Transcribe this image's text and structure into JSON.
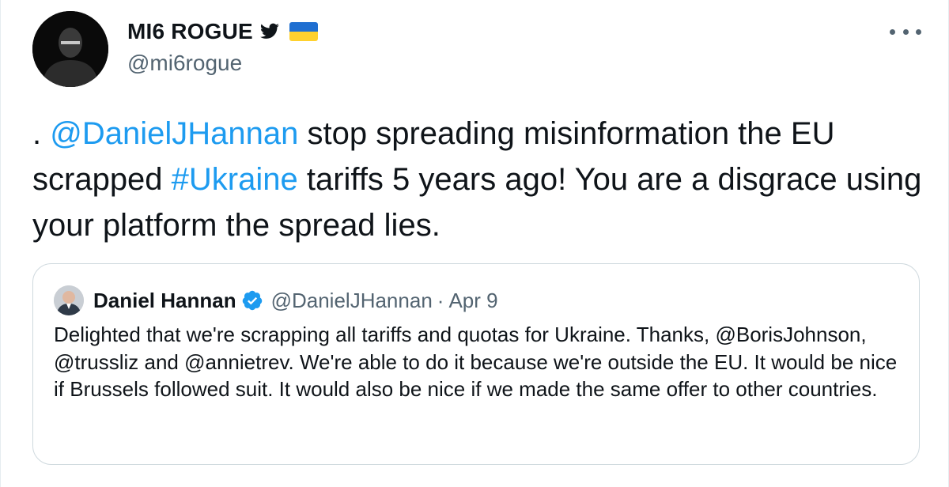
{
  "author": {
    "name": "MI6 ROGUE",
    "handle": "@mi6rogue"
  },
  "tweet": {
    "prefix": ". ",
    "mention": "@DanielJHannan",
    "part2": " stop spreading misinformation the EU scrapped ",
    "hashtag": "#Ukraine",
    "part3": " tariffs 5 years ago! You are a disgrace using your platform the spread lies."
  },
  "quoted": {
    "name": "Daniel Hannan",
    "handle": "@DanielJHannan",
    "separator": "·",
    "date": "Apr 9",
    "text": "Delighted that we're scrapping all tariffs and quotas for Ukraine. Thanks, @BorisJohnson, @trussliz and @annietrev. We're able to do it because we're outside the EU. It would be nice if Brussels followed suit. It would also be nice if we made the same offer to other countries."
  },
  "icons": {
    "more": "more-horizontal-icon",
    "bird": "twitter-bird-icon",
    "flag": "ukraine-flag-icon",
    "verified": "verified-badge-icon"
  },
  "colors": {
    "link": "#1d9bf0",
    "text": "#0f1419",
    "secondary": "#536471",
    "border": "#cfd9de",
    "flag_blue": "#1f6fd1",
    "flag_yellow": "#ffd12e"
  }
}
